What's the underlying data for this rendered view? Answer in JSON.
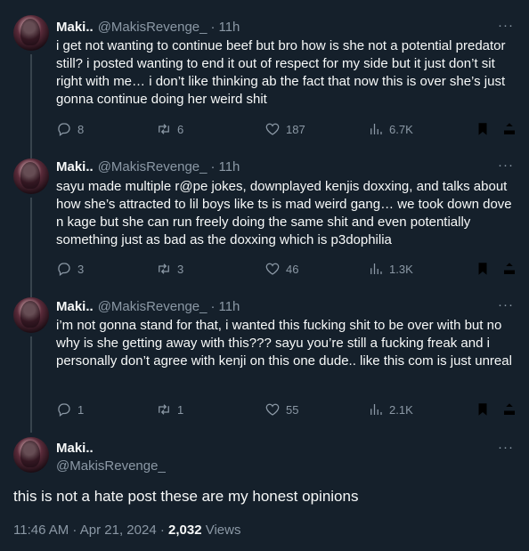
{
  "tweets": [
    {
      "name": "Maki..",
      "handle": "@MakisRevenge_",
      "time": "11h",
      "text": "i get not wanting to continue beef but bro how is she not a potential predator still? i posted wanting to end it out of respect for my side but it just don’t sit right with me… i don’t like thinking ab the fact that now this is over she’s just gonna continue doing her weird shit",
      "replies": "8",
      "retweets": "6",
      "likes": "187",
      "views": "6.7K"
    },
    {
      "name": "Maki..",
      "handle": "@MakisRevenge_",
      "time": "11h",
      "text": "sayu made multiple r@pe jokes, downplayed kenjis doxxing, and talks about how she’s attracted to lil boys like ts is mad weird gang… we took down dove n kage but she can run freely doing the same shit and even potentially something just as bad as the doxxing which is p3dophilia",
      "replies": "3",
      "retweets": "3",
      "likes": "46",
      "views": "1.3K"
    },
    {
      "name": "Maki..",
      "handle": "@MakisRevenge_",
      "time": "11h",
      "text": "i’m not gonna stand for that, i wanted this fucking shit to be over with but no why is she getting away with this??? sayu you’re still a fucking freak and i personally don’t agree with kenji on this one dude.. like this com is just unreal",
      "replies": "1",
      "retweets": "1",
      "likes": "55",
      "views": "2.1K"
    }
  ],
  "main": {
    "name": "Maki..",
    "handle": "@MakisRevenge_",
    "text": "this is not a hate post these are my honest opinions",
    "timestamp": "11:46 AM · Apr 21, 2024 · ",
    "views_count": "2,032",
    "views_label": " Views"
  },
  "separator": "·",
  "more_icon": "···",
  "icons": [
    "more-icon",
    "reply-icon",
    "retweet-icon",
    "like-icon",
    "views-icon",
    "bookmark-icon",
    "share-icon"
  ],
  "colors": {
    "background": "#15202b",
    "text": "#f7f9f9",
    "secondary": "#8b98a5",
    "thread": "#38444d"
  }
}
